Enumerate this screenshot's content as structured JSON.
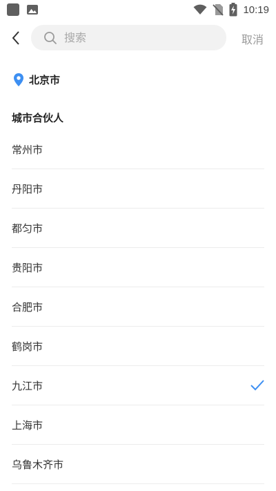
{
  "status_bar": {
    "time": "10:19",
    "icons": [
      "notification-square-icon",
      "image-icon",
      "wifi-icon",
      "no-sim-icon",
      "battery-charging-icon"
    ]
  },
  "header": {
    "back_icon": "chevron-left-icon",
    "search_placeholder": "搜索",
    "search_value": "",
    "cancel_label": "取消"
  },
  "current_location": {
    "icon": "location-pin-icon",
    "label": "北京市"
  },
  "section": {
    "title": "城市合伙人"
  },
  "cities": [
    {
      "label": "常州市",
      "selected": false
    },
    {
      "label": "丹阳市",
      "selected": false
    },
    {
      "label": "都匀市",
      "selected": false
    },
    {
      "label": "贵阳市",
      "selected": false
    },
    {
      "label": "合肥市",
      "selected": false
    },
    {
      "label": "鹤岗市",
      "selected": false
    },
    {
      "label": "九江市",
      "selected": true
    },
    {
      "label": "上海市",
      "selected": false
    },
    {
      "label": "乌鲁木齐市",
      "selected": false
    }
  ],
  "colors": {
    "accent": "#3d8ff2",
    "search_bg": "#f2f2f2",
    "divider": "#ececec",
    "muted_text": "#9a9a9a"
  }
}
